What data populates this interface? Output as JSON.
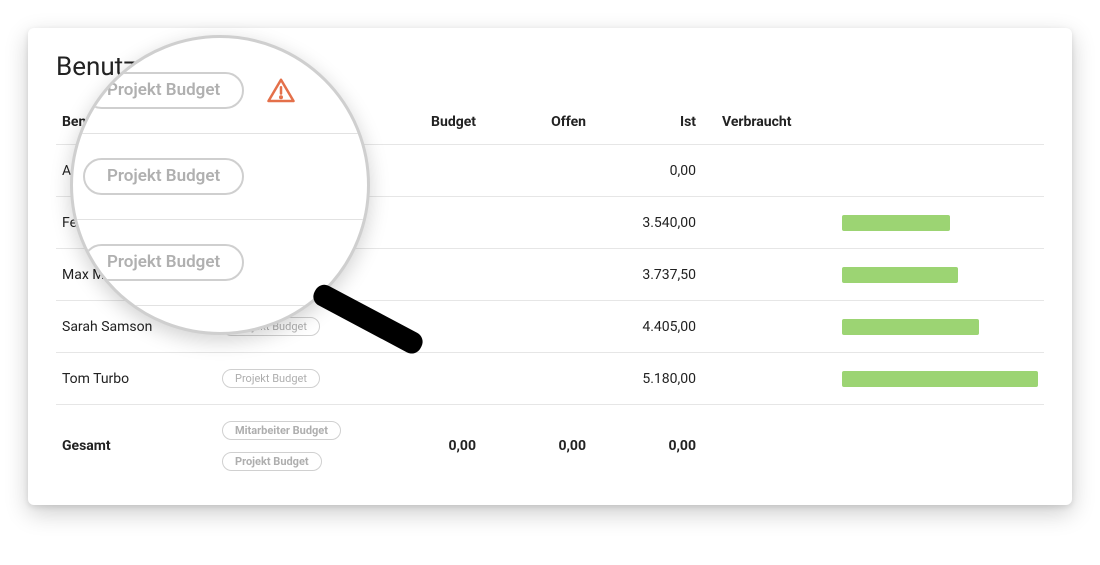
{
  "heading": "Benutzer",
  "columns": {
    "user": "Benutzer",
    "budget": "Budget",
    "offen": "Offen",
    "ist": "Ist",
    "verbraucht": "Verbraucht"
  },
  "badge_labels": {
    "projekt": "Projekt Budget",
    "mitarbeiter": "Mitarbeiter Budget"
  },
  "rows": [
    {
      "name": "Anna Arbeit",
      "badge": "Projekt Budget",
      "ist": "0,00",
      "bar_pct": 0
    },
    {
      "name": "Felix Frisch",
      "badge": "Projekt Budget",
      "ist": "3.540,00",
      "bar_pct": 55
    },
    {
      "name": "Max Mustermann",
      "badge": "Projekt Budget",
      "ist": "3.737,50",
      "bar_pct": 59
    },
    {
      "name": "Sarah Samson",
      "badge": "Projekt Budget",
      "ist": "4.405,00",
      "bar_pct": 70
    },
    {
      "name": "Tom Turbo",
      "badge": "Projekt Budget",
      "ist": "5.180,00",
      "bar_pct": 100
    }
  ],
  "total": {
    "label": "Gesamt",
    "badges": [
      "Mitarbeiter Budget",
      "Projekt Budget"
    ],
    "budget": "0,00",
    "offen": "0,00",
    "ist": "0,00"
  },
  "lens": {
    "pill1": "Projekt Budget",
    "pill2": "Projekt Budget",
    "pill3": "Projekt Budget"
  }
}
